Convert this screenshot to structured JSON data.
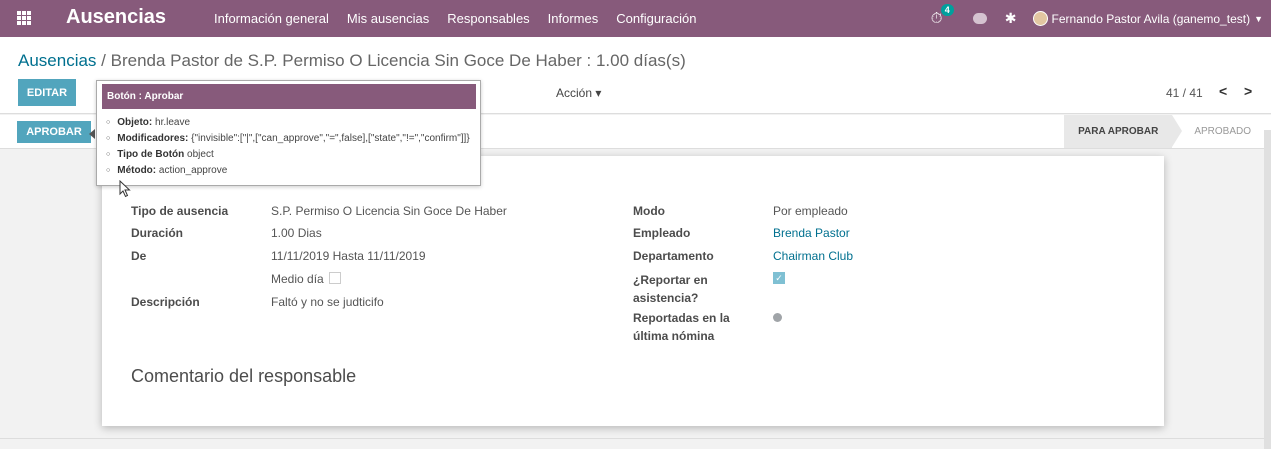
{
  "navbar": {
    "app_title": "Ausencias",
    "menu": [
      "Información general",
      "Mis ausencias",
      "Responsables",
      "Informes",
      "Configuración"
    ],
    "activity_count": "4",
    "user": "Fernando Pastor Avila (ganemo_test)",
    "icons": [
      "apps-icon",
      "activity-icon",
      "chat-icon",
      "bug-icon",
      "avatar",
      "caret-down-icon"
    ]
  },
  "breadcrumb": {
    "parent": "Ausencias",
    "separator": " / ",
    "current": "Brenda Pastor de S.P. Permiso O Licencia Sin Goce De Haber : 1.00 días(s)"
  },
  "control": {
    "edit_label": "EDITAR",
    "action_label": "Acción ▾",
    "pager": "41 / 41",
    "prev_icon": "chevron-left-icon",
    "next_icon": "chevron-right-icon"
  },
  "statusbar": {
    "approve_label": "APROBAR",
    "steps": [
      "PARA APROBAR",
      "APROBADO"
    ],
    "active_step": "PARA APROBAR"
  },
  "tooltip": {
    "title": "Botón : Aprobar",
    "rows": [
      {
        "label": "Objeto:",
        "value": "hr.leave"
      },
      {
        "label": "Modificadores:",
        "value": "{\"invisible\":[\"|\",[\"can_approve\",\"=\",false],[\"state\",\"!=\",\"confirm\"]]}"
      },
      {
        "label": "Tipo de Botón",
        "value": "object"
      },
      {
        "label": "Método:",
        "value": "action_approve"
      }
    ]
  },
  "form": {
    "left": [
      {
        "label": "Tipo de ausencia",
        "value": "S.P. Permiso O Licencia Sin Goce De Haber"
      },
      {
        "label": "Duración",
        "value": "1.00  Dias"
      },
      {
        "label": "De",
        "value": "11/11/2019  Hasta  11/11/2019"
      },
      {
        "label": "",
        "value": "Medio día"
      },
      {
        "label": "Descripción",
        "value": "Faltó y no se judticifo"
      }
    ],
    "half_day_checked": false,
    "right": [
      {
        "label": "Modo",
        "value": "Por empleado"
      },
      {
        "label": "Empleado",
        "value": "Brenda Pastor"
      },
      {
        "label": "Departamento",
        "value": "Chairman Club"
      },
      {
        "label": "¿Reportar en asistencia?",
        "value": ""
      },
      {
        "label": "Reportadas en la última nómina",
        "value": ""
      }
    ],
    "report_attendance_checked": true,
    "reported_last_payslip": false,
    "section_title": "Comentario del responsable"
  }
}
